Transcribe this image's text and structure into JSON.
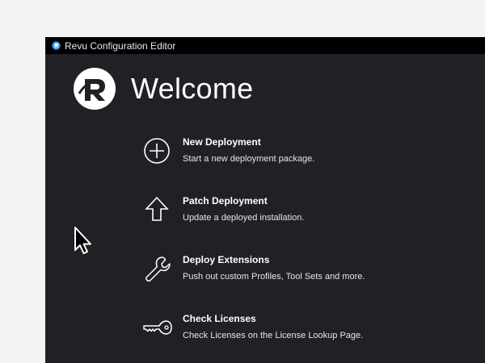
{
  "window": {
    "title": "Revu Configuration Editor",
    "background": "#202124",
    "titlebar_color": "#000000"
  },
  "hero": {
    "logo_icon": "revu-logo-icon",
    "heading": "Welcome"
  },
  "menu": {
    "items": [
      {
        "icon": "plus-circle-icon",
        "title": "New Deployment",
        "description": "Start a new deployment package."
      },
      {
        "icon": "arrow-up-icon",
        "title": "Patch Deployment",
        "description": "Update a deployed installation."
      },
      {
        "icon": "wrench-icon",
        "title": "Deploy Extensions",
        "description": "Push out custom Profiles, Tool Sets and more."
      },
      {
        "icon": "key-icon",
        "title": "Check Licenses",
        "description": "Check Licenses on the License Lookup Page."
      }
    ]
  },
  "cursor": {
    "icon": "mouse-pointer-icon"
  }
}
